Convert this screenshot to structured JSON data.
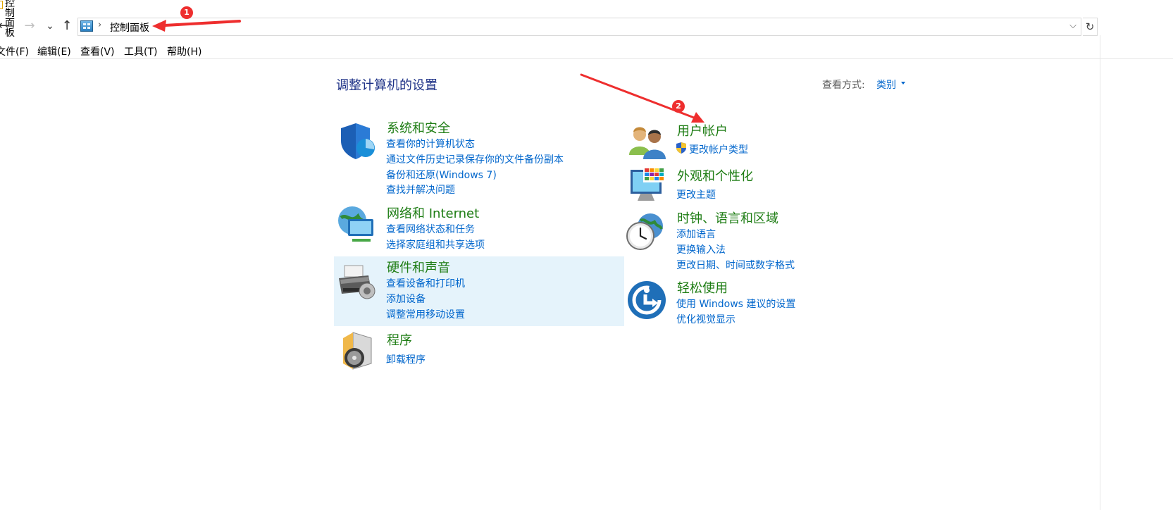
{
  "window": {
    "title": "控制面板"
  },
  "address_bar": {
    "crumb": "控制面板",
    "crumb_separator": "›",
    "dropdown_icon": "chevron-down-icon",
    "refresh_icon": "refresh-icon"
  },
  "nav": {
    "back": "←",
    "forward": "→",
    "recent": "⌄",
    "up": "↑"
  },
  "menu": [
    "文件(F)",
    "编辑(E)",
    "查看(V)",
    "工具(T)",
    "帮助(H)"
  ],
  "content": {
    "heading": "调整计算机的设置",
    "view_by_label": "查看方式:",
    "view_by_value": "类别",
    "left_categories": [
      {
        "title": "系统和安全",
        "icon": "shield-icon",
        "links": [
          "查看你的计算机状态",
          "通过文件历史记录保存你的文件备份副本",
          "备份和还原(Windows 7)",
          "查找并解决问题"
        ]
      },
      {
        "title": "网络和 Internet",
        "icon": "network-globe-icon",
        "links": [
          "查看网络状态和任务",
          "选择家庭组和共享选项"
        ]
      },
      {
        "title": "硬件和声音",
        "icon": "printer-icon",
        "links": [
          "查看设备和打印机",
          "添加设备",
          "调整常用移动设置"
        ]
      },
      {
        "title": "程序",
        "icon": "programs-icon",
        "links": [
          "卸载程序"
        ]
      }
    ],
    "right_categories": [
      {
        "title": "用户帐户",
        "icon": "users-icon",
        "links": [
          "更改帐户类型"
        ],
        "link_icon": "uac-shield-icon"
      },
      {
        "title": "外观和个性化",
        "icon": "monitor-palette-icon",
        "links": [
          "更改主题"
        ]
      },
      {
        "title": "时钟、语言和区域",
        "icon": "clock-globe-icon",
        "links": [
          "添加语言",
          "更换输入法",
          "更改日期、时间或数字格式"
        ]
      },
      {
        "title": "轻松使用",
        "icon": "ease-of-access-icon",
        "links": [
          "使用 Windows 建议的设置",
          "优化视觉显示"
        ]
      }
    ]
  },
  "annotations": [
    {
      "label": "1",
      "color": "#ee2e2e"
    },
    {
      "label": "2",
      "color": "#ee2e2e"
    }
  ]
}
